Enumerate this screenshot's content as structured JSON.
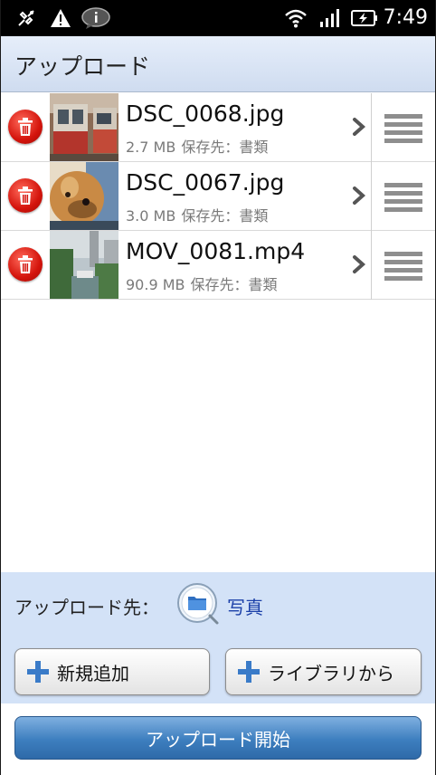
{
  "status_bar": {
    "time": "7:49",
    "icons": [
      "usb-debug-icon",
      "warning-icon",
      "message-icon",
      "wifi-icon",
      "signal-icon",
      "battery-charging-icon"
    ]
  },
  "header": {
    "title": "アップロード"
  },
  "upload_list": {
    "items": [
      {
        "filename": "DSC_0068.jpg",
        "size": "2.7 MB",
        "destination": "保存先：書類",
        "thumbnail": "tram-photo"
      },
      {
        "filename": "DSC_0067.jpg",
        "size": "3.0 MB",
        "destination": "保存先：書類",
        "thumbnail": "dog-photo"
      },
      {
        "filename": "MOV_0081.mp4",
        "size": "90.9 MB",
        "destination": "保存先：書類",
        "thumbnail": "canal-video"
      }
    ]
  },
  "upload_target": {
    "label": "アップロード先：",
    "value": "写真",
    "icon": "folder-icon"
  },
  "buttons": {
    "add_new": "新規追加",
    "from_library": "ライブラリから",
    "start_upload": "アップロード開始"
  },
  "colors": {
    "accent": "#3d7ebf",
    "panel": "#d3e2f7",
    "delete": "#d4140c",
    "link": "#1a3fa8"
  }
}
